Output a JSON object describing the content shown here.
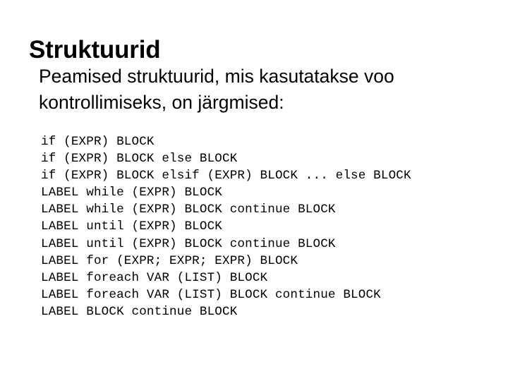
{
  "slide": {
    "title": "Struktuurid",
    "background_color": "#ffffff",
    "text_color": "#000000",
    "body": {
      "lines": [
        "Peamised struktuurid, mis kasutatakse voo",
        "kontrollimiseks, on järgmised:"
      ],
      "full_text": "Peamised struktuurid, mis kasutatakse voo kontrollimiseks, on järgmised:"
    },
    "code": {
      "lines": [
        "if (EXPR) BLOCK",
        "if (EXPR) BLOCK else BLOCK",
        "if (EXPR) BLOCK elsif (EXPR) BLOCK ... else BLOCK",
        "LABEL while (EXPR) BLOCK",
        "LABEL while (EXPR) BLOCK continue BLOCK",
        "LABEL until (EXPR) BLOCK",
        "LABEL until (EXPR) BLOCK continue BLOCK",
        "LABEL for (EXPR; EXPR; EXPR) BLOCK",
        "LABEL foreach VAR (LIST) BLOCK",
        "LABEL foreach VAR (LIST) BLOCK continue BLOCK",
        "LABEL BLOCK continue BLOCK"
      ]
    }
  }
}
